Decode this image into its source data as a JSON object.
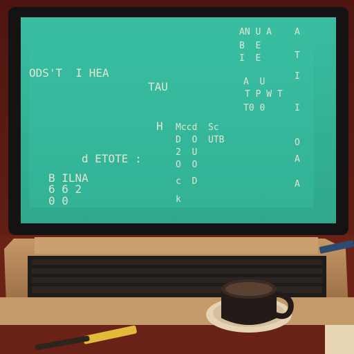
{
  "scene": {
    "description_colors": {
      "background": "#5a1a12",
      "monitor_bezel": "#141212",
      "screen": "#34b497",
      "screen_highlight": "#3cc2a3",
      "text": "#f1ead8",
      "desk": "#6a2216",
      "keyboard_body": "#b58a5a",
      "keys_dark": "#1f1b18",
      "mug": "#231b18"
    }
  },
  "screen_text": {
    "line1": "ODS'T  I HEA",
    "line2": "TAU",
    "line3": "H",
    "line4": "d ETOTE :",
    "line5": "B ILNA",
    "line6": "6 6 2",
    "line7": "0 0",
    "col_a1": "A",
    "col_a2": "T",
    "col_a3": "I",
    "col_a4": "I",
    "col_a5": "O",
    "col_a6": "A",
    "col_a7": "A",
    "tpwt": "T P W T",
    "too": "T0 0",
    "mid1": "Mccd  Sc",
    "mid2": "D  O  UTB",
    "mid3": "2  U",
    "mid4": "O  O",
    "mid5": "c  D",
    "mid6": "k",
    "top1": "AN U A",
    "top2": "B  E",
    "top3": "I  E",
    "top4": "A  U"
  }
}
